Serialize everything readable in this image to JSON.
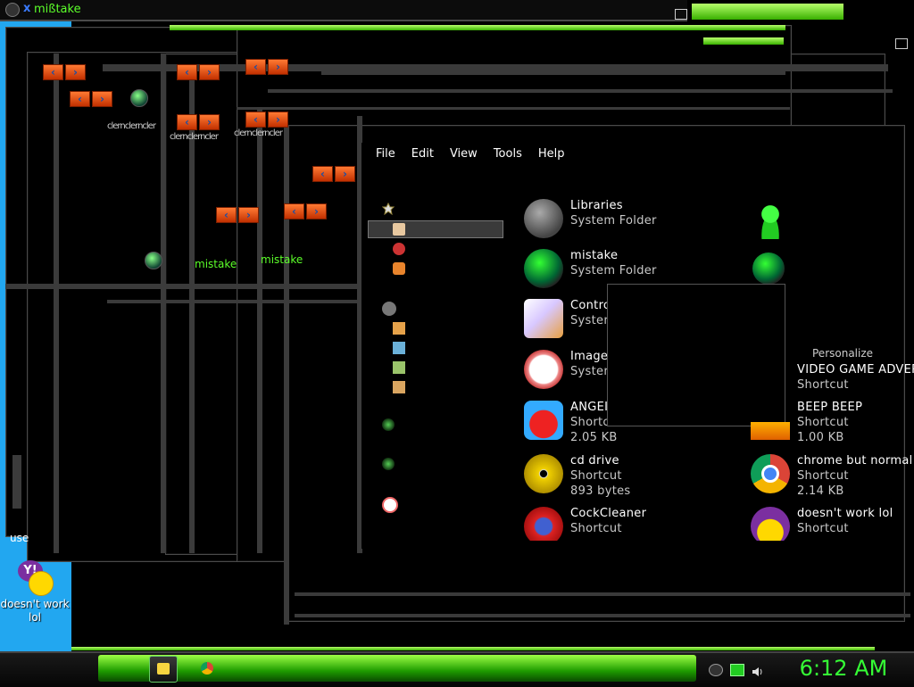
{
  "window": {
    "title": "mißtake"
  },
  "ghost_windows": {
    "title_a": "mistake",
    "title_b": "mistake",
    "breadcrumb_fragment": "clernclerncler"
  },
  "menu": [
    {
      "label": "File"
    },
    {
      "label": "Edit"
    },
    {
      "label": "View"
    },
    {
      "label": "Tools"
    },
    {
      "label": "Help"
    }
  ],
  "items_left": [
    {
      "name": "Libraries",
      "sub": "System Folder",
      "size": "",
      "icon": "libraries-icon"
    },
    {
      "name": "mistake",
      "sub": "System Folder",
      "size": "",
      "icon": "user-folder-icon"
    },
    {
      "name": "Contro",
      "sub": "Syster",
      "size": "",
      "icon": "control-panel-icon"
    },
    {
      "name": "Image",
      "sub": "Syster",
      "size": "",
      "icon": "imageshack-icon"
    },
    {
      "name": "ANGEI",
      "sub": "Shortcut",
      "size": "2.05 KB",
      "icon": "angry-birds-icon"
    },
    {
      "name": "cd drive",
      "sub": "Shortcut",
      "size": "893 bytes",
      "icon": "cd-drive-icon"
    },
    {
      "name": "CockCleaner",
      "sub": "Shortcut",
      "size": "",
      "icon": "ccleaner-icon"
    }
  ],
  "items_right": [
    {
      "name": "VIDEO GAME ADVER",
      "sub": "Shortcut",
      "size": "",
      "icon": "shortcut-icon"
    },
    {
      "name": "BEEP BEEP",
      "sub": "Shortcut",
      "size": "1.00 KB",
      "icon": "vlc-icon"
    },
    {
      "name": "chrome but normal c",
      "sub": "Shortcut",
      "size": "2.14 KB",
      "icon": "chrome-icon"
    },
    {
      "name": "doesn't work lol",
      "sub": "Shortcut",
      "size": "",
      "icon": "yahoo-messenger-icon"
    }
  ],
  "context": {
    "personalize": "Personalize"
  },
  "desktop": {
    "icon_label": "doesn't work lol",
    "partial_label": "use"
  },
  "taskbar": {
    "time": "6:12 AM"
  },
  "colors": {
    "accent": "#5cff2a",
    "clock": "#35ff35",
    "desktop_blue": "#22a7f0"
  }
}
